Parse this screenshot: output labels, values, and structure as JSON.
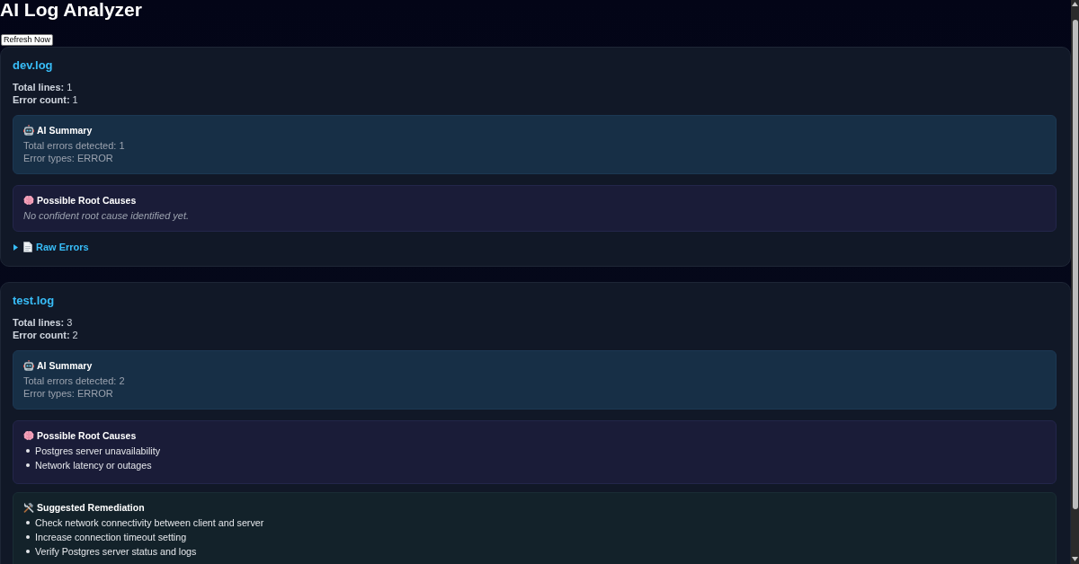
{
  "page": {
    "title": "AI Log Analyzer"
  },
  "refresh_button": {
    "label": "Refresh Now"
  },
  "logs": [
    {
      "filename": "dev.log",
      "stats": [
        "**Total lines:** 1",
        "**Error count:** 1"
      ],
      "sections": [
        {
          "kind": "summary",
          "title": "AI Summary",
          "lines": [
            "Total errors detected: 1",
            "Error types: ERROR"
          ]
        },
        {
          "kind": "root_causes",
          "title": "Possible Root Causes",
          "note": "No confident root cause identified yet."
        }
      ],
      "raw_errors": {
        "label": "Raw Errors",
        "expanded": false
      }
    },
    {
      "filename": "test.log",
      "stats": [
        "**Total lines:** 3",
        "**Error count:** 2"
      ],
      "sections": [
        {
          "kind": "summary",
          "title": "AI Summary",
          "lines": [
            "Total errors detected: 2",
            "Error types: ERROR"
          ]
        },
        {
          "kind": "root_causes",
          "title": "Possible Root Causes",
          "items": [
            "Postgres server unavailability",
            "Network latency or outages"
          ]
        },
        {
          "kind": "remediation",
          "title": "Suggested Remediation",
          "items": [
            "Check network connectivity between client and server",
            "Increase connection timeout setting",
            "Verify Postgres server status and logs"
          ]
        }
      ]
    }
  ]
}
